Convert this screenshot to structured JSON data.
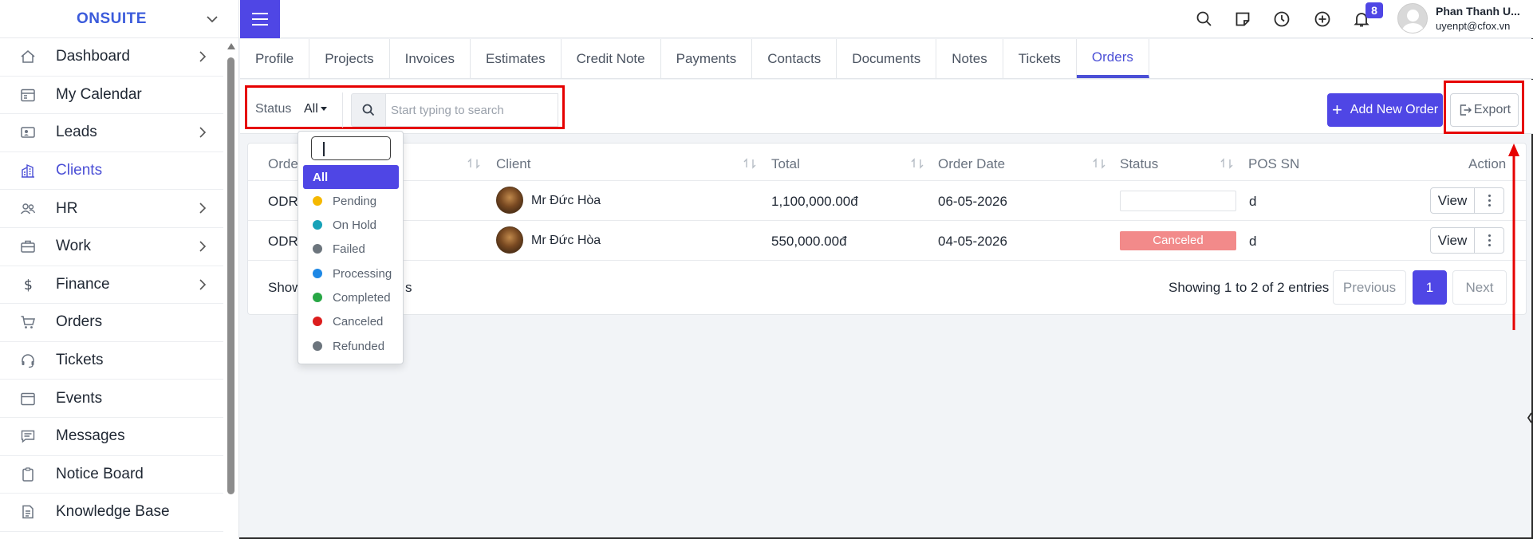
{
  "app": {
    "name": "ONSUITE"
  },
  "sidebar": {
    "items": [
      {
        "label": "Dashboard",
        "icon": "house-icon",
        "has_children": true
      },
      {
        "label": "My Calendar",
        "icon": "calendar-icon",
        "has_children": false
      },
      {
        "label": "Leads",
        "icon": "id-card-icon",
        "has_children": true
      },
      {
        "label": "Clients",
        "icon": "building-icon",
        "has_children": false,
        "active": true
      },
      {
        "label": "HR",
        "icon": "people-icon",
        "has_children": true
      },
      {
        "label": "Work",
        "icon": "briefcase-icon",
        "has_children": true
      },
      {
        "label": "Finance",
        "icon": "dollar-icon",
        "has_children": true
      },
      {
        "label": "Orders",
        "icon": "cart-icon",
        "has_children": false
      },
      {
        "label": "Tickets",
        "icon": "headset-icon",
        "has_children": false
      },
      {
        "label": "Events",
        "icon": "calendar-event-icon",
        "has_children": false
      },
      {
        "label": "Messages",
        "icon": "chat-icon",
        "has_children": false
      },
      {
        "label": "Notice Board",
        "icon": "clipboard-icon",
        "has_children": false
      },
      {
        "label": "Knowledge Base",
        "icon": "document-icon",
        "has_children": false
      }
    ]
  },
  "header": {
    "notification_count": "8",
    "user": {
      "name": "Phan Thanh U...",
      "email": "uyenpt@cfox.vn"
    }
  },
  "tabs": [
    {
      "label": "Profile"
    },
    {
      "label": "Projects"
    },
    {
      "label": "Invoices"
    },
    {
      "label": "Estimates"
    },
    {
      "label": "Credit Note"
    },
    {
      "label": "Payments"
    },
    {
      "label": "Contacts"
    },
    {
      "label": "Documents"
    },
    {
      "label": "Notes"
    },
    {
      "label": "Tickets"
    },
    {
      "label": "Orders",
      "active": true
    }
  ],
  "filters": {
    "status_label": "Status",
    "status_value": "All",
    "search_placeholder": "Start typing to search",
    "add_button": "Add New Order",
    "export_button": "Export"
  },
  "status_dropdown": {
    "options": [
      {
        "label": "All",
        "selected": true
      },
      {
        "label": "Pending",
        "color": "#f5b800"
      },
      {
        "label": "On Hold",
        "color": "#17a2b8"
      },
      {
        "label": "Failed",
        "color": "#6c757d"
      },
      {
        "label": "Processing",
        "color": "#1e88e5"
      },
      {
        "label": "Completed",
        "color": "#28a745"
      },
      {
        "label": "Canceled",
        "color": "#dc1d1d"
      },
      {
        "label": "Refunded",
        "color": "#6c757d"
      }
    ]
  },
  "table": {
    "columns": [
      "Orde",
      "Client",
      "Total",
      "Order Date",
      "Status",
      "POS SN",
      "Action"
    ],
    "rows": [
      {
        "order": "ODR",
        "client": "Mr Đức Hòa",
        "total": "1,100,000.00đ",
        "date": "06-05-2026",
        "status": "",
        "pos_sn": "d",
        "view": "View"
      },
      {
        "order": "ODR",
        "client": "Mr Đức Hòa",
        "total": "550,000.00đ",
        "date": "04-05-2026",
        "status": "Canceled",
        "pos_sn": "d",
        "view": "View"
      }
    ],
    "footer_left": "Show",
    "footer_left_tail": "s",
    "entries_info": "Showing 1 to 2 of 2 entries",
    "pager": {
      "prev": "Previous",
      "current": "1",
      "next": "Next"
    }
  },
  "colors": {
    "primary": "#4f46e5",
    "brand": "#3b5bdb",
    "highlight": "#e60000",
    "canceled": "#f28a8a"
  }
}
